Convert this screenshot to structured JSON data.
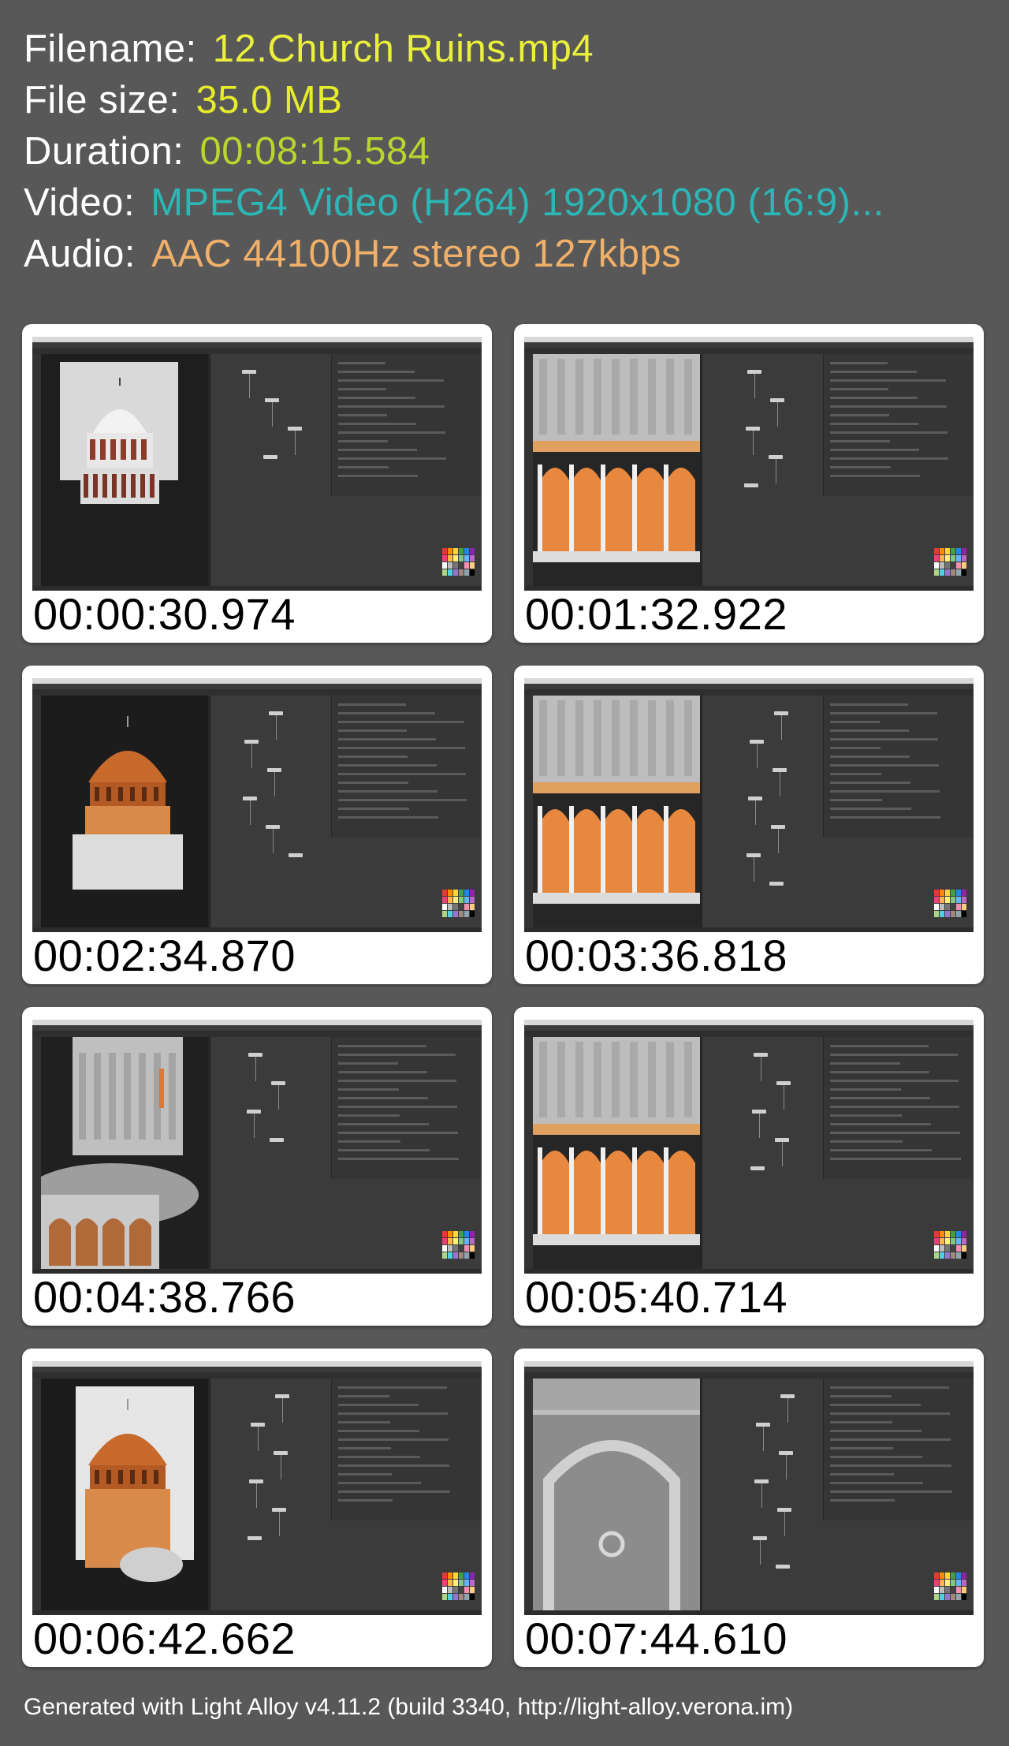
{
  "header": {
    "filename": {
      "label": "Filename:",
      "value": "12.Church Ruins.mp4"
    },
    "filesize": {
      "label": "File size:",
      "value": "35.0 MB"
    },
    "duration": {
      "label": "Duration:",
      "value": "00:08:15.584"
    },
    "video": {
      "label": "Video:",
      "value": "MPEG4 Video (H264) 1920x1080 (16:9)..."
    },
    "audio": {
      "label": "Audio:",
      "value": "AAC 44100Hz stereo 127kbps"
    }
  },
  "colors": {
    "filename": "#eaf03a",
    "filesize": "#e6ec2a",
    "duration": "#b9d52e",
    "video": "#2cb6b6",
    "audio": "#f0b06a",
    "background": "#585858"
  },
  "frames": [
    {
      "timestamp": "00:00:30.974",
      "scene": "front-elevation"
    },
    {
      "timestamp": "00:01:32.922",
      "scene": "arcade-closeup"
    },
    {
      "timestamp": "00:02:34.870",
      "scene": "dome-exterior"
    },
    {
      "timestamp": "00:03:36.818",
      "scene": "tower-arcade"
    },
    {
      "timestamp": "00:04:38.766",
      "scene": "wireframe-base"
    },
    {
      "timestamp": "00:05:40.714",
      "scene": "tower-arcade"
    },
    {
      "timestamp": "00:06:42.662",
      "scene": "dome-ruins"
    },
    {
      "timestamp": "00:07:44.610",
      "scene": "arch-wall"
    }
  ],
  "footer": "Generated with Light Alloy v4.11.2 (build 3340, http://light-alloy.verona.im)"
}
